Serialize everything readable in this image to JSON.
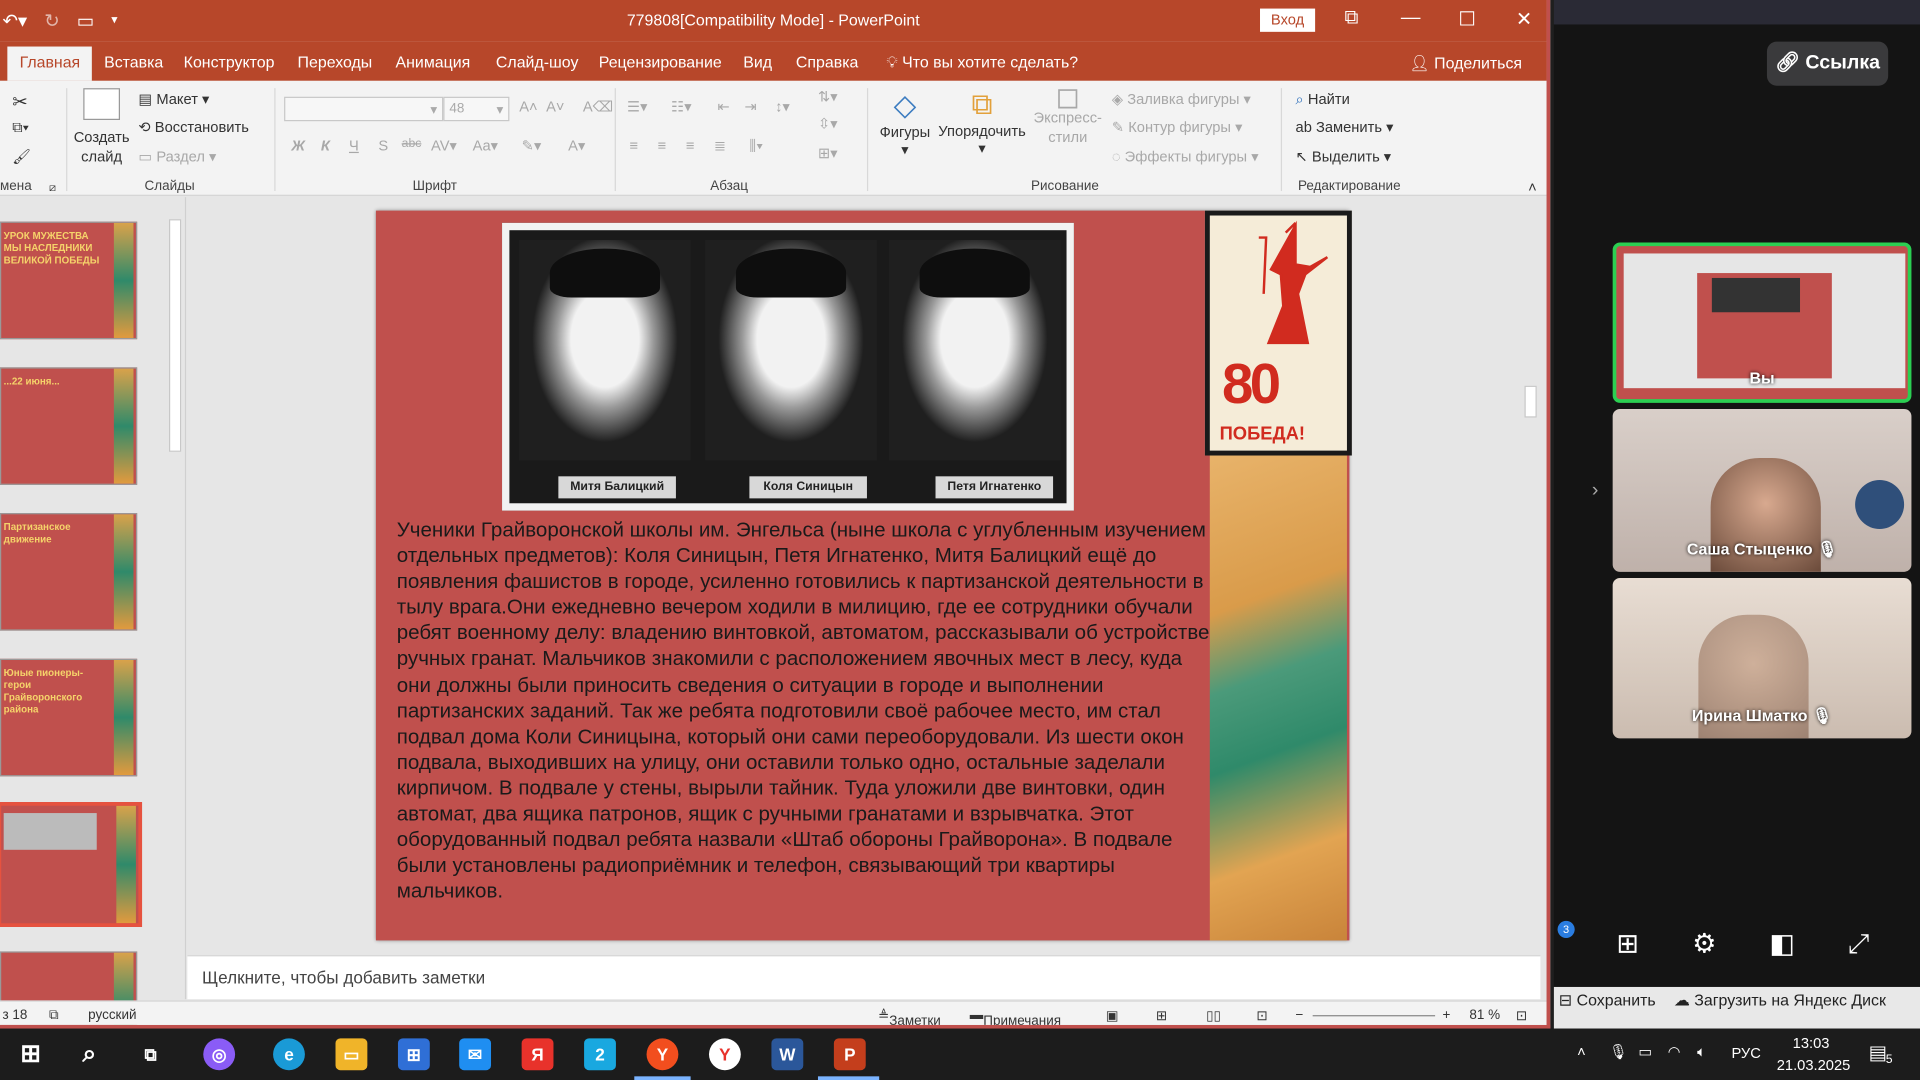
{
  "window": {
    "title": "779808[Compatibility Mode]  -  PowerPoint",
    "login": "Вход"
  },
  "tabs": [
    "Главная",
    "Вставка",
    "Конструктор",
    "Переходы",
    "Анимация",
    "Слайд-шоу",
    "Рецензирование",
    "Вид",
    "Справка"
  ],
  "tell_me": "Что вы хотите сделать?",
  "share": "Поделиться",
  "ribbon": {
    "clipboard_label": "мена",
    "new_slide": "Создать слайд",
    "layout": "Макет",
    "reset": "Восстановить",
    "section": "Раздел",
    "slides_label": "Слайды",
    "font_size": "48",
    "font_label": "Шрифт",
    "paragraph_label": "Абзац",
    "shapes": "Фигуры",
    "arrange": "Упорядочить",
    "quick_styles": "Экспресс-стили",
    "shape_fill": "Заливка фигуры",
    "shape_outline": "Контур фигуры",
    "shape_effects": "Эффекты фигуры",
    "drawing_label": "Рисование",
    "find": "Найти",
    "replace": "Заменить",
    "select": "Выделить",
    "editing_label": "Редактирование"
  },
  "thumbnails": [
    {
      "title": "УРОК МУЖЕСТВА\nМЫ НАСЛЕДНИКИ\nВЕЛИКОЙ ПОБЕДЫ"
    },
    {
      "title": "...22 июня..."
    },
    {
      "title": "Партизанское движение"
    },
    {
      "title": "Юные пионеры-герои Грайворонского района"
    },
    {
      "title": ""
    },
    {
      "title": ""
    }
  ],
  "slide": {
    "names": [
      "Митя Балицкий",
      "Коля Синицын",
      "Петя Игнатенко"
    ],
    "text": "Ученики Грайворонской школы им. Энгельса (ныне школа с углубленным изучением отдельных предметов): Коля Синицын, Петя Игнатенко, Митя Балицкий ещё до появления фашистов в городе, усиленно готовились к партизанской деятельности в тылу врага.Они ежедневно вечером ходили в милицию, где ее сотрудники обучали ребят военному делу: владению винтовкой, автоматом, рассказывали об устройстве ручных гранат. Мальчиков знакомили с расположением явочных мест в лесу, куда они должны были приносить сведения о ситуации в городе и выполнении партизанских заданий. Так же ребята подготовили своё рабочее место, им стал подвал дома Коли Синицына, который они сами переоборудовали. Из шести окон подвала, выходивших на улицу, они оставили только одно, остальные заделали кирпичом. В подвале у стены, вырыли тайник. Туда уложили две винтовки, один автомат, два ящика патронов, ящик с ручными гранатами и взрывчатка. Этот оборудованный подвал ребята назвали «Штаб обороны Грайворона». В подвале были установлены радиоприёмник и телефон, связывающий три квартиры мальчиков.",
    "poster_number": "80",
    "poster_word": "ПОБЕДА!"
  },
  "notes_placeholder": "Щелкните, чтобы добавить заметки",
  "status": {
    "slide": "з 18",
    "language": "русский",
    "notes": "Заметки",
    "comments": "Примечания",
    "zoom": "81 %"
  },
  "meeting": {
    "link": "Ссылка",
    "participants": [
      {
        "name": "Вы"
      },
      {
        "name": "Саша Стыценко"
      },
      {
        "name": "Ирина Шматко"
      }
    ],
    "badge": "3",
    "save": "Сохранить",
    "upload": "Загрузить на Яндекс Диск"
  },
  "taskbar": {
    "lang": "РУС",
    "time": "13:03",
    "date": "21.03.2025",
    "notif": "5"
  },
  "colors": {
    "ppt_accent": "#b7472a",
    "slide_bg": "#c0504d"
  }
}
